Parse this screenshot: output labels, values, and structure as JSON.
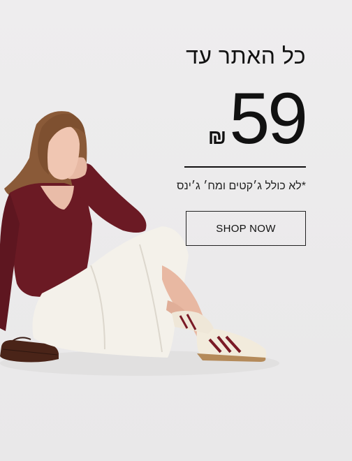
{
  "promo": {
    "headline": "כל האתר עד",
    "price_value": "59",
    "currency_symbol": "₪",
    "disclaimer": "*לא כולל ג׳קטים ומח׳ ג׳ינס",
    "cta_label": "SHOP NOW"
  },
  "colors": {
    "background": "#ecebec",
    "text": "#111111",
    "sweater": "#6b1a24",
    "skirt": "#f4f1ea"
  }
}
